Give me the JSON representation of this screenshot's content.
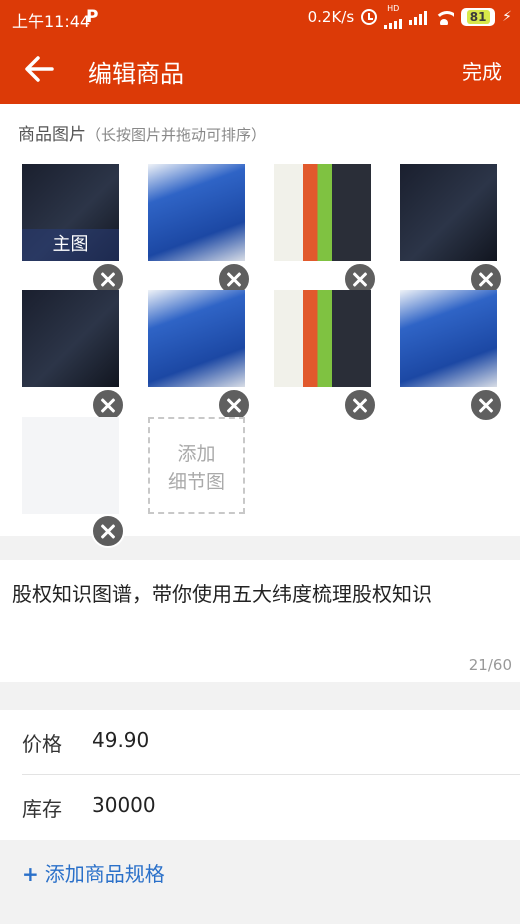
{
  "status": {
    "time": "上午11:44",
    "app_icon": "P",
    "speed": "0.2K/s",
    "hd": "HD",
    "battery": "81"
  },
  "nav": {
    "title": "编辑商品",
    "done": "完成"
  },
  "images": {
    "hint": "商品图片",
    "hint_sub": "（长按图片并拖动可排序）",
    "main_label": "主图",
    "add_detail_line1": "添加",
    "add_detail_line2": "细节图"
  },
  "product": {
    "title": "股权知识图谱，带你使用五大纬度梳理股权知识",
    "counter": "21/60"
  },
  "form": {
    "price_label": "价格",
    "price_value": "49.90",
    "stock_label": "库存",
    "stock_value": "30000"
  },
  "add_spec": "添加商品规格",
  "colors": {
    "brand": "#dc3a07",
    "link": "#2a70c9"
  }
}
